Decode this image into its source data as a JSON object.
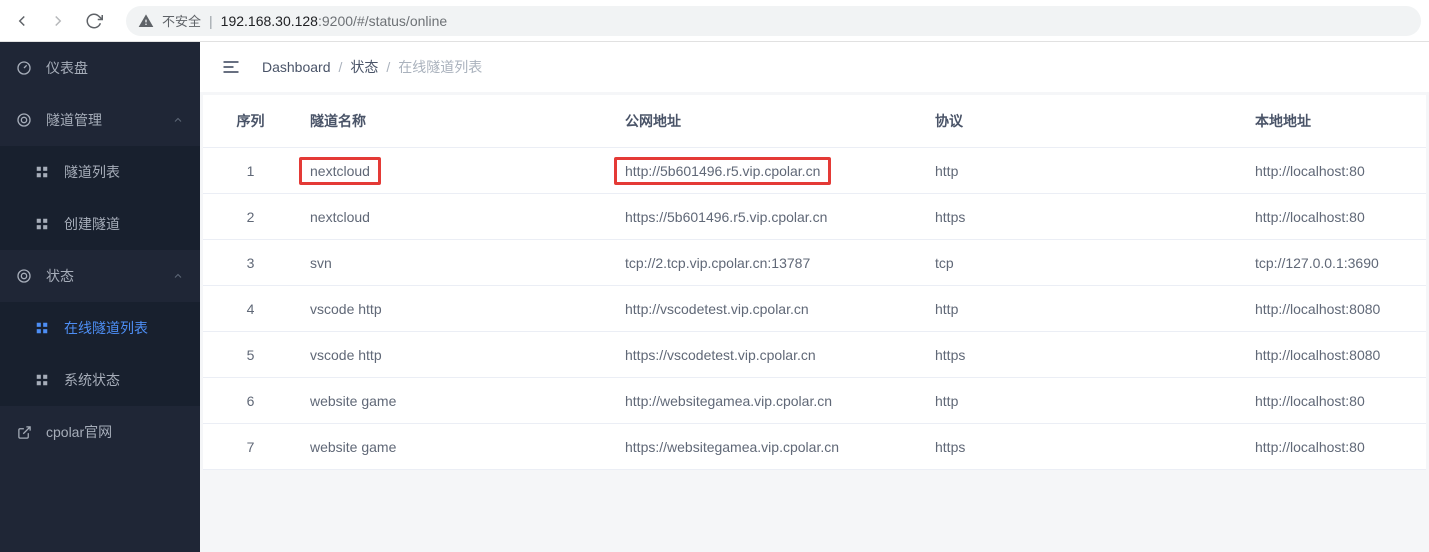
{
  "browser": {
    "not_secure_label": "不安全",
    "url_host": "192.168.30.128",
    "url_rest": ":9200/#/status/online"
  },
  "sidebar": {
    "dashboard": "仪表盘",
    "tunnel_mgmt": "隧道管理",
    "tunnel_list": "隧道列表",
    "create_tunnel": "创建隧道",
    "status": "状态",
    "online_list": "在线隧道列表",
    "sys_status": "系统状态",
    "cpolar_site": "cpolar官网"
  },
  "breadcrumb": {
    "dashboard": "Dashboard",
    "status": "状态",
    "online_list": "在线隧道列表"
  },
  "table": {
    "headers": {
      "idx": "序列",
      "name": "隧道名称",
      "public": "公网地址",
      "proto": "协议",
      "local": "本地地址"
    },
    "rows": [
      {
        "idx": "1",
        "name": "nextcloud",
        "public": "http://5b601496.r5.vip.cpolar.cn",
        "proto": "http",
        "local": "http://localhost:80",
        "hl": true
      },
      {
        "idx": "2",
        "name": "nextcloud",
        "public": "https://5b601496.r5.vip.cpolar.cn",
        "proto": "https",
        "local": "http://localhost:80"
      },
      {
        "idx": "3",
        "name": "svn",
        "public": "tcp://2.tcp.vip.cpolar.cn:13787",
        "proto": "tcp",
        "local": "tcp://127.0.0.1:3690"
      },
      {
        "idx": "4",
        "name": "vscode http",
        "public": "http://vscodetest.vip.cpolar.cn",
        "proto": "http",
        "local": "http://localhost:8080"
      },
      {
        "idx": "5",
        "name": "vscode http",
        "public": "https://vscodetest.vip.cpolar.cn",
        "proto": "https",
        "local": "http://localhost:8080"
      },
      {
        "idx": "6",
        "name": "website game",
        "public": "http://websitegamea.vip.cpolar.cn",
        "proto": "http",
        "local": "http://localhost:80"
      },
      {
        "idx": "7",
        "name": "website game",
        "public": "https://websitegamea.vip.cpolar.cn",
        "proto": "https",
        "local": "http://localhost:80"
      }
    ]
  }
}
